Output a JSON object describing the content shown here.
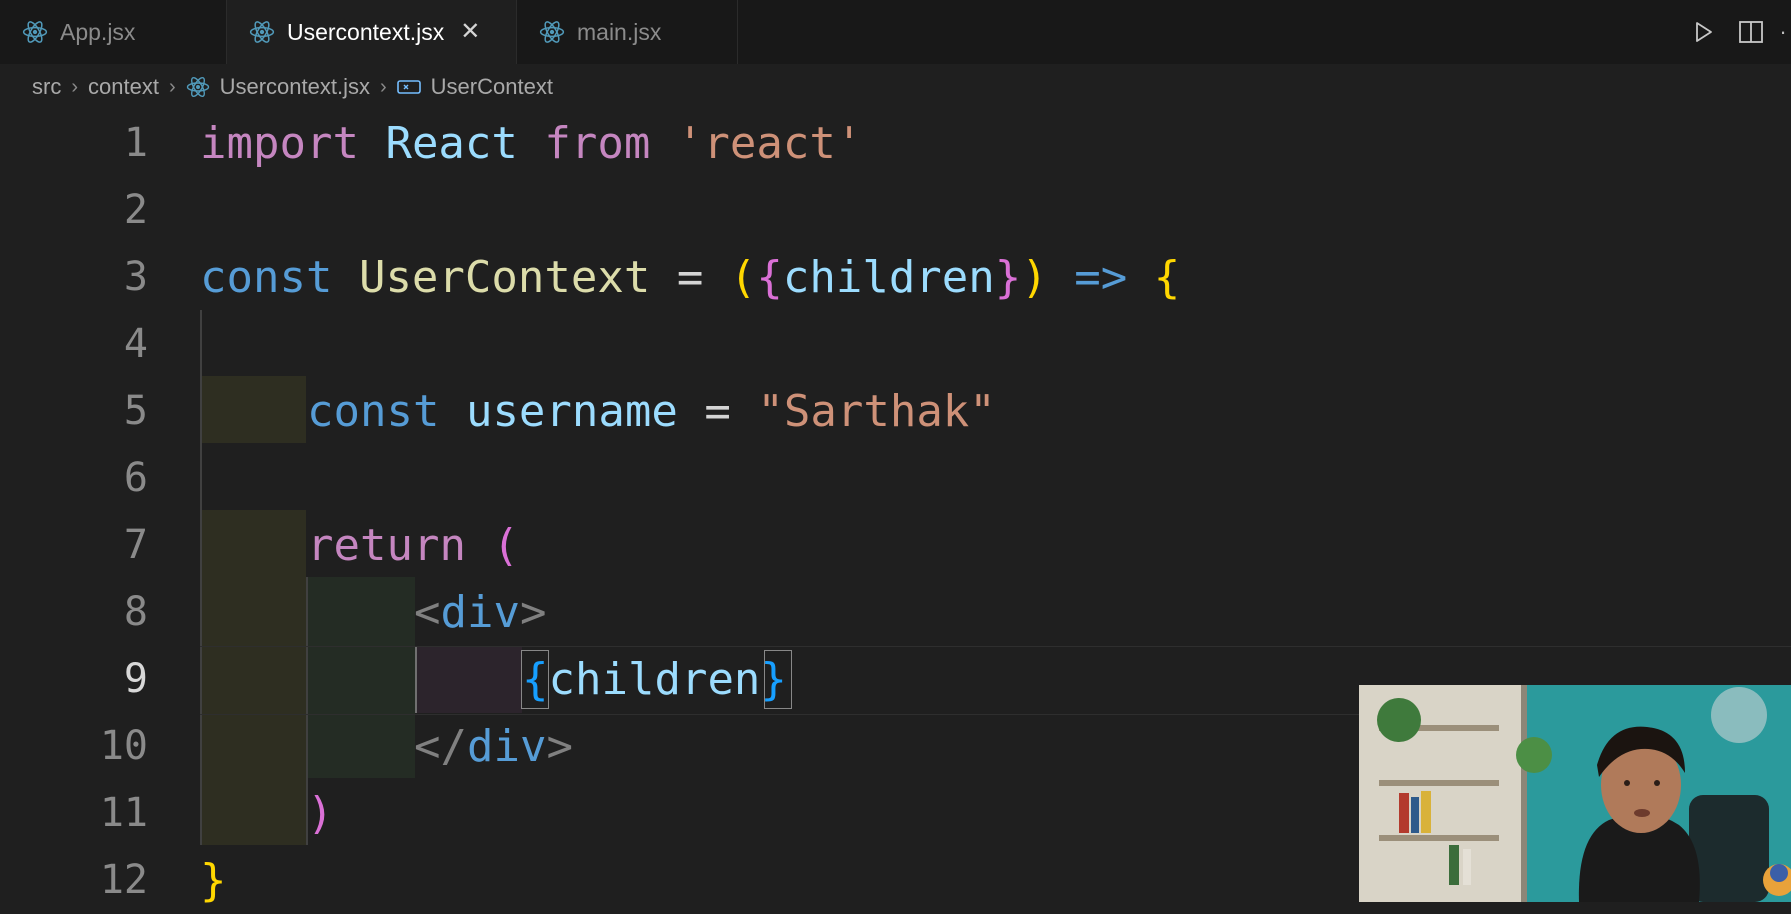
{
  "tabs": [
    {
      "label": "App.jsx",
      "active": false
    },
    {
      "label": "Usercontext.jsx",
      "active": true,
      "close": "✕"
    },
    {
      "label": "main.jsx",
      "active": false
    }
  ],
  "breadcrumb": {
    "items": [
      "src",
      "context",
      "Usercontext.jsx",
      "UserContext"
    ],
    "separator": "›"
  },
  "editor": {
    "line_numbers": [
      "1",
      "2",
      "3",
      "4",
      "5",
      "6",
      "7",
      "8",
      "9",
      "10",
      "11",
      "12"
    ],
    "current_line": "9",
    "lines": {
      "l1": {
        "kw_import": "import",
        "react_ident": "React",
        "kw_from": "from",
        "str_react": "'react'"
      },
      "l3": {
        "kw_const": "const",
        "fn_name": "UserContext",
        "eq": "=",
        "paren_open": "(",
        "brace_open": "{",
        "param": "children",
        "brace_close": "}",
        "paren_close": ")",
        "arrow": "=>",
        "body_open": "{"
      },
      "l5": {
        "kw_const": "const",
        "var_name": "username",
        "eq": "=",
        "str_value": "\"Sarthak\""
      },
      "l7": {
        "kw_return": "return",
        "paren_open": "("
      },
      "l8": {
        "lt": "<",
        "tag": "div",
        "gt": ">"
      },
      "l9": {
        "brace_open": "{",
        "ident": "children",
        "brace_close": "}"
      },
      "l10": {
        "lt": "</",
        "tag": "div",
        "gt": ">"
      },
      "l11": {
        "paren_close": ")"
      },
      "l12": {
        "body_close": "}"
      }
    }
  },
  "colors": {
    "editor_bg": "#1f1f1f",
    "tabbar_bg": "#181818",
    "keyword_purple": "#c586c0",
    "keyword_blue": "#569cd6",
    "function_yellow": "#dcdcaa",
    "variable_blue": "#9cdcfe",
    "string_orange": "#ce9178",
    "react_icon": "#519aba"
  },
  "icons": {
    "tab_icon": "react-icon",
    "run": "run-icon",
    "split": "split-editor-icon",
    "more": "more-actions-icon",
    "breadcrumb_symbol": "symbol-variable-icon"
  },
  "editor_actions": {
    "more": "·"
  }
}
